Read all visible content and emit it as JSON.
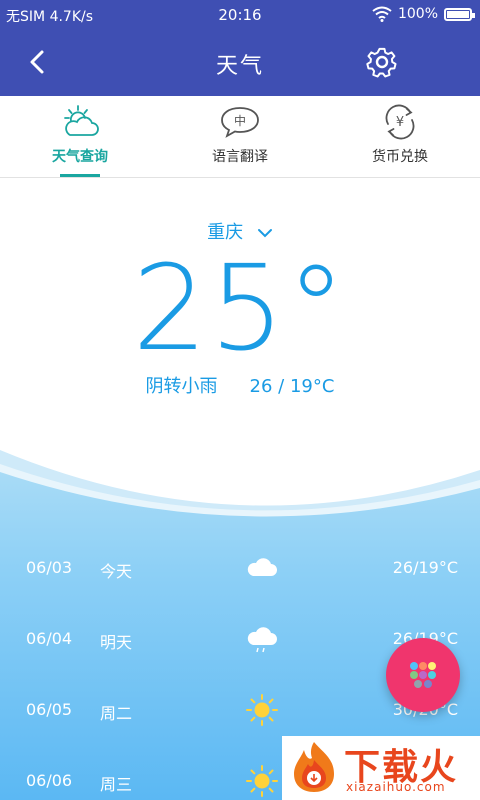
{
  "status_bar": {
    "carrier": "无SIM",
    "speed": "4.7K/s",
    "time": "20:16",
    "battery": "100%"
  },
  "nav": {
    "title": "天气"
  },
  "tabs": [
    {
      "label": "天气查询",
      "icon": "weather-icon",
      "active": true
    },
    {
      "label": "语言翻译",
      "icon": "translate-icon",
      "active": false
    },
    {
      "label": "货币兑换",
      "icon": "currency-icon",
      "active": false
    }
  ],
  "weather": {
    "city": "重庆",
    "temperature": "25°",
    "condition": "阴转小雨",
    "range": "26 / 19°C"
  },
  "forecast": [
    {
      "date": "06/03",
      "day": "今天",
      "icon": "cloud-icon",
      "temp": "26/19°C"
    },
    {
      "date": "06/04",
      "day": "明天",
      "icon": "cloud-rain-icon",
      "temp": "26/19°C"
    },
    {
      "date": "06/05",
      "day": "周二",
      "icon": "sun-icon",
      "temp": "30/20°C"
    },
    {
      "date": "06/06",
      "day": "周三",
      "icon": "sun-icon",
      "temp": ""
    }
  ],
  "watermark": {
    "brand": "下载火",
    "site": "xiazaihuo.com"
  },
  "colors": {
    "primary": "#3f4fb3",
    "accent": "#1aa6a0",
    "temp": "#1a9be4",
    "fab": "#f0356d"
  }
}
